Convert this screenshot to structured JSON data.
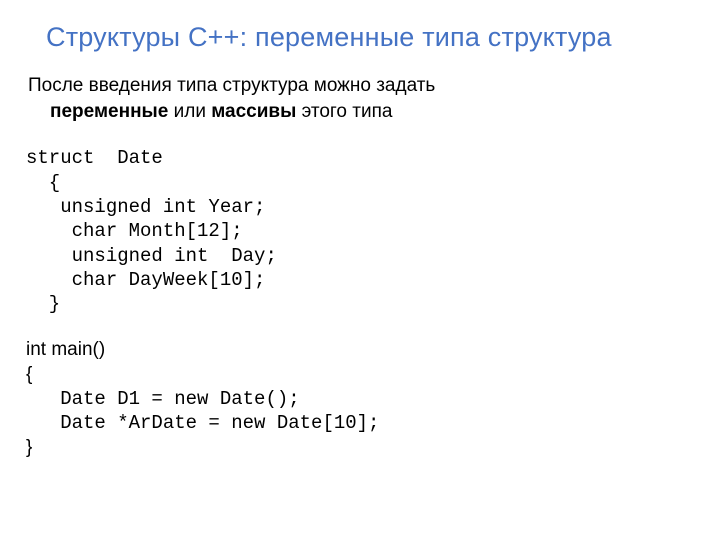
{
  "title": "Структуры С++: переменные типа структура",
  "intro_line1_a": "После   введения   типа   структура   можно   задать",
  "intro_line2_a": "переменные",
  "intro_line2_b": " или ",
  "intro_line2_c": "массивы",
  "intro_line2_d": "  этого типа",
  "code1": "struct  Date\n  {\n   unsigned int Year;\n    char Month[12];\n    unsigned int  Day;\n    char DayWeek[10];\n  }",
  "code2_l1": "int main()",
  "code2_l2": "{",
  "code2_l3": "   Date D1 = new Date();",
  "code2_l4": "   Date *ArDate = new Date[10];",
  "code2_l5": "}"
}
